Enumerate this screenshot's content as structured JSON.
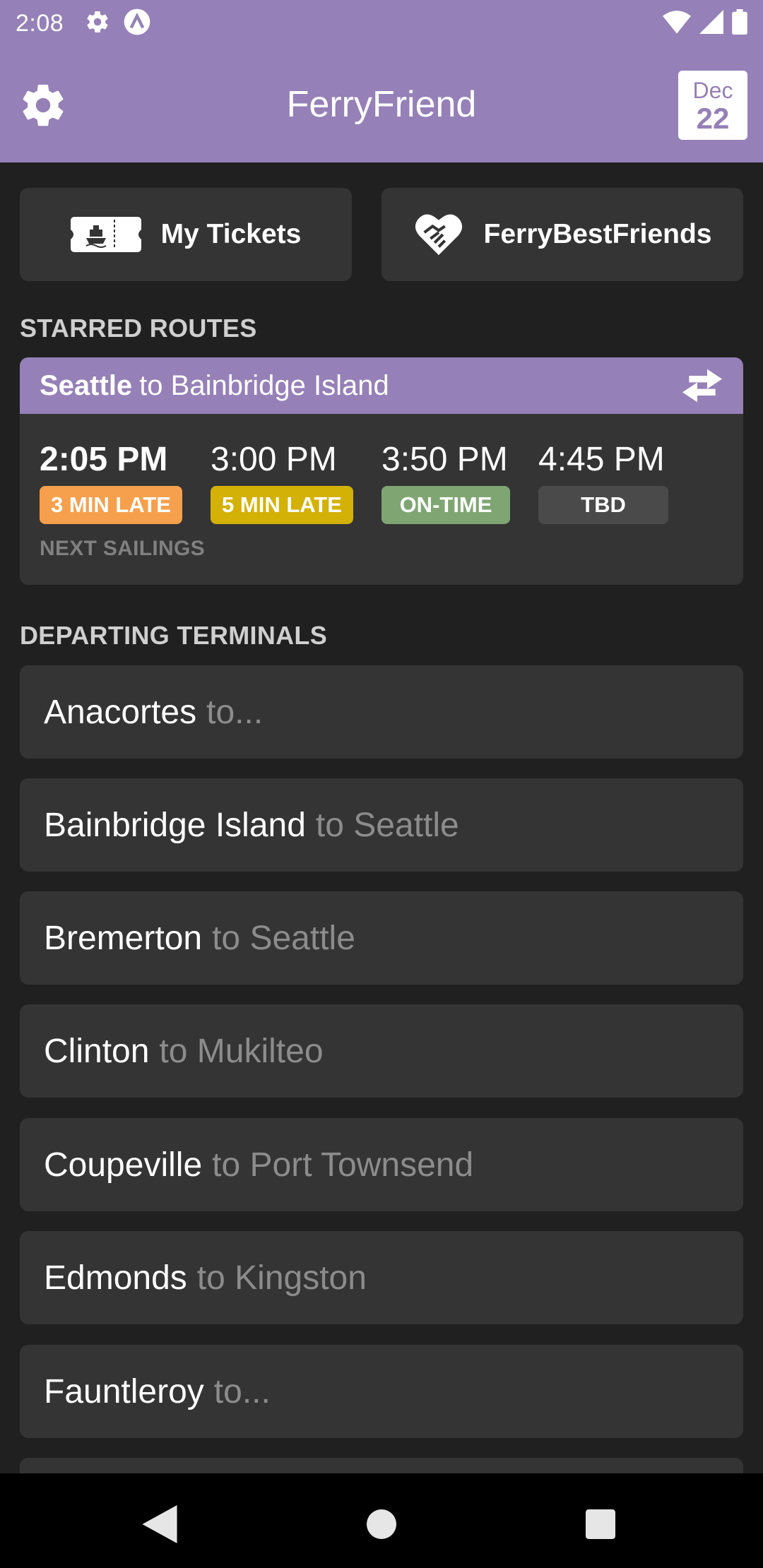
{
  "status_bar": {
    "time": "2:08"
  },
  "app_bar": {
    "title": "FerryFriend",
    "date_month": "Dec",
    "date_day": "22"
  },
  "quick_actions": {
    "tickets_label": "My Tickets",
    "friends_label": "FerryBestFriends"
  },
  "starred": {
    "header": "STARRED ROUTES",
    "route_from": "Seattle",
    "route_to": "to Bainbridge Island",
    "sailings": [
      {
        "time": "2:05 PM",
        "status": "3 MIN LATE",
        "color": "#f6a04d"
      },
      {
        "time": "3:00 PM",
        "status": "5 MIN LATE",
        "color": "#d4b106"
      },
      {
        "time": "3:50 PM",
        "status": "ON-TIME",
        "color": "#7fa672"
      },
      {
        "time": "4:45 PM",
        "status": "TBD",
        "color": "#4a4a4a"
      }
    ],
    "next_label": "NEXT SAILINGS"
  },
  "departing": {
    "header": "DEPARTING TERMINALS",
    "terminals": [
      {
        "name": "Anacortes",
        "dest": "to..."
      },
      {
        "name": "Bainbridge Island",
        "dest": "to Seattle"
      },
      {
        "name": "Bremerton",
        "dest": "to Seattle"
      },
      {
        "name": "Clinton",
        "dest": "to Mukilteo"
      },
      {
        "name": "Coupeville",
        "dest": "to Port Townsend"
      },
      {
        "name": "Edmonds",
        "dest": "to Kingston"
      },
      {
        "name": "Fauntleroy",
        "dest": "to..."
      }
    ]
  },
  "theme": {
    "accent": "#9580b7",
    "background": "#202020",
    "card": "#343434"
  }
}
